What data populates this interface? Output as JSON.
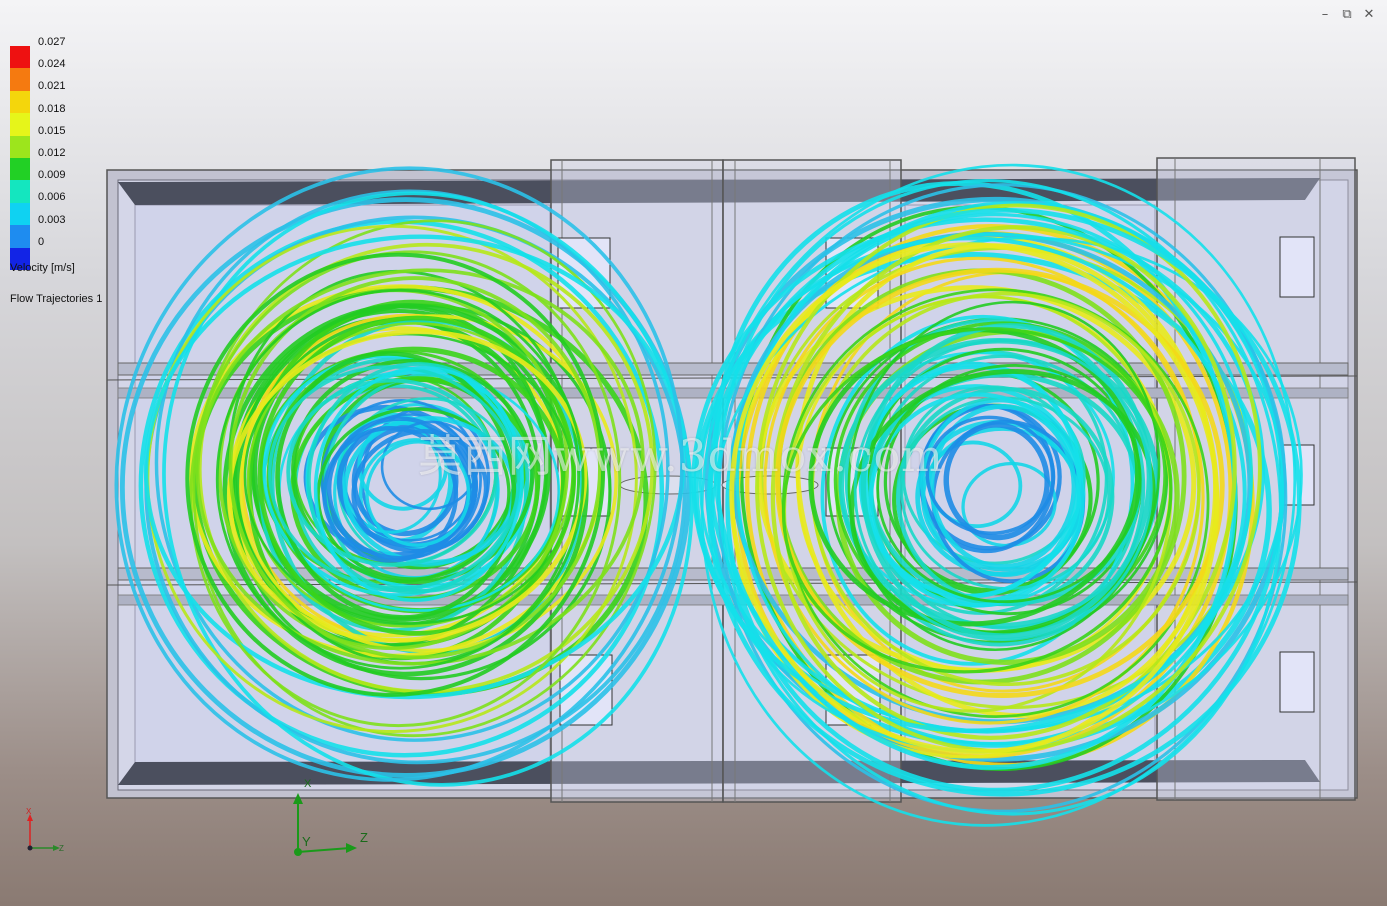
{
  "window": {
    "controls": [
      {
        "name": "minimize",
        "glyph": "–"
      },
      {
        "name": "restore",
        "glyph": "⧉"
      },
      {
        "name": "close",
        "glyph": "✕"
      }
    ]
  },
  "legend": {
    "ticks": [
      "0.027",
      "0.024",
      "0.021",
      "0.018",
      "0.015",
      "0.012",
      "0.009",
      "0.006",
      "0.003",
      "0"
    ],
    "colors": [
      "#ee1111",
      "#f57a10",
      "#f4d60c",
      "#e6f51a",
      "#9de51c",
      "#22d025",
      "#14e6bf",
      "#0fd2f2",
      "#1e8cf0",
      "#1224e6"
    ],
    "title": "Velocity [m/s]",
    "subtitle": "Flow Trajectories 1"
  },
  "watermark": "莫西网www.3dmox.com",
  "triad": {
    "y_label": "Y",
    "z_label": "Z"
  },
  "mini_triad": {
    "x_label": "X",
    "z_label": "Z"
  }
}
